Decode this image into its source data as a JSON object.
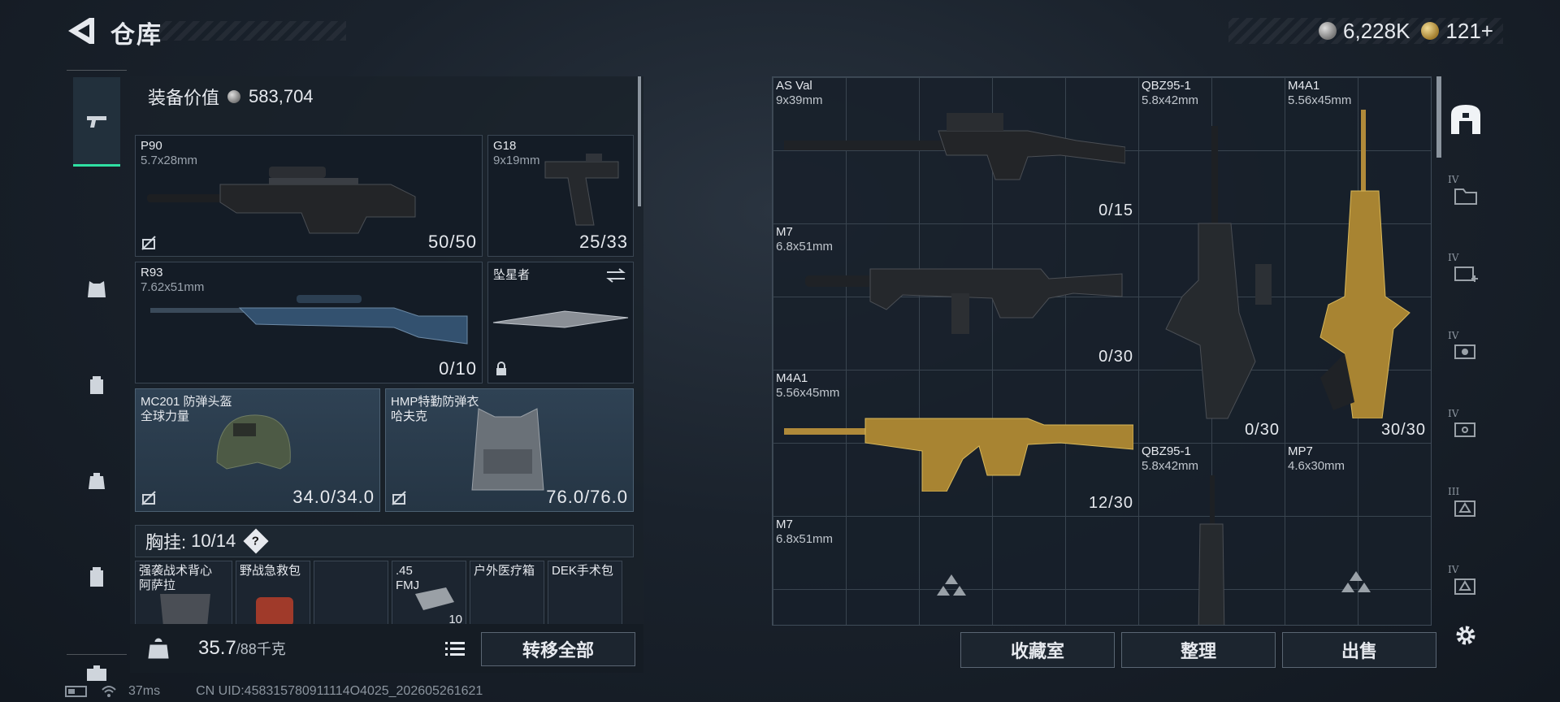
{
  "header": {
    "title": "仓库"
  },
  "currency": [
    {
      "value": "6,228K",
      "icon": "silver-coin-icon",
      "color": "#c0c0c0"
    },
    {
      "value": "121+",
      "icon": "gold-coin-icon",
      "color": "#c9a544"
    }
  ],
  "left_rail": [
    {
      "id": "weapons",
      "icon": "pistol-icon",
      "active": true
    },
    {
      "id": "armor",
      "icon": "vest-icon"
    },
    {
      "id": "backpack",
      "icon": "backpack-icon"
    },
    {
      "id": "pouch",
      "icon": "pouch-icon"
    },
    {
      "id": "case",
      "icon": "case-icon"
    },
    {
      "id": "toolbox",
      "icon": "toolbox-icon"
    }
  ],
  "loadout": {
    "equipment_value_label": "装备价值",
    "equipment_value": "583,704",
    "slots": [
      {
        "name": "P90",
        "sub": "5.7x28mm",
        "ammo": "50/50"
      },
      {
        "name": "G18",
        "sub": "9x19mm",
        "ammo": "25/33"
      },
      {
        "name": "R93",
        "sub": "7.62x51mm",
        "ammo": "0/10"
      },
      {
        "name": "坠星者",
        "sub": "",
        "ammo": ""
      },
      {
        "name": "MC201 防弹头盔",
        "sub": "全球力量",
        "ammo": "34.0/34.0"
      },
      {
        "name": "HMP特勤防弹衣",
        "sub": "哈夫克",
        "ammo": "76.0/76.0"
      }
    ],
    "chest_rig_label": "胸挂:",
    "chest_rig_value": "10/14",
    "chest_rig_help": "?",
    "small_slots": [
      {
        "name": "强袭战术背心",
        "sub": "阿萨拉"
      },
      {
        "name": "野战急救包",
        "sub": ""
      },
      {
        "name": "",
        "sub": ""
      },
      {
        "name": ".45",
        "sub": "FMJ"
      },
      {
        "name": "户外医疗箱",
        "sub": ""
      },
      {
        "name": "DEK手术包",
        "sub": ""
      }
    ],
    "small_count": "10",
    "weight_value": "35.7",
    "weight_max": "/88千克",
    "transfer_all": "转移全部"
  },
  "status": {
    "ping": "37ms",
    "uid": "CN UID:458315780911114O4025_202605261621"
  },
  "storage": {
    "items": [
      {
        "name": "AS Val",
        "sub": "9x39mm",
        "ammo": "0/15"
      },
      {
        "name": "QBZ95-1",
        "sub": "5.8x42mm",
        "ammo": "0/30"
      },
      {
        "name": "M4A1",
        "sub": "5.56x45mm",
        "ammo": "30/30"
      },
      {
        "name": "M7",
        "sub": "6.8x51mm",
        "ammo": "0/30"
      },
      {
        "name": "M4A1",
        "sub": "5.56x45mm",
        "ammo": "12/30"
      },
      {
        "name": "QBZ95-1",
        "sub": "5.8x42mm",
        "ammo": ""
      },
      {
        "name": "MP7",
        "sub": "4.6x30mm",
        "ammo": ""
      },
      {
        "name": "M7",
        "sub": "6.8x51mm",
        "ammo": ""
      }
    ]
  },
  "actions": {
    "collection": "收藏室",
    "sort": "整理",
    "sell": "出售"
  },
  "right_rail": [
    {
      "tag": "",
      "icon": "storage-icon"
    },
    {
      "tag": "IV",
      "icon": "folder-icon"
    },
    {
      "tag": "IV",
      "icon": "medkit-plus-icon"
    },
    {
      "tag": "IV",
      "icon": "camera-tools-icon"
    },
    {
      "tag": "IV",
      "icon": "ammo-box-icon"
    },
    {
      "tag": "III",
      "icon": "triangle-box-icon"
    },
    {
      "tag": "IV",
      "icon": "triangle-box-icon"
    }
  ]
}
